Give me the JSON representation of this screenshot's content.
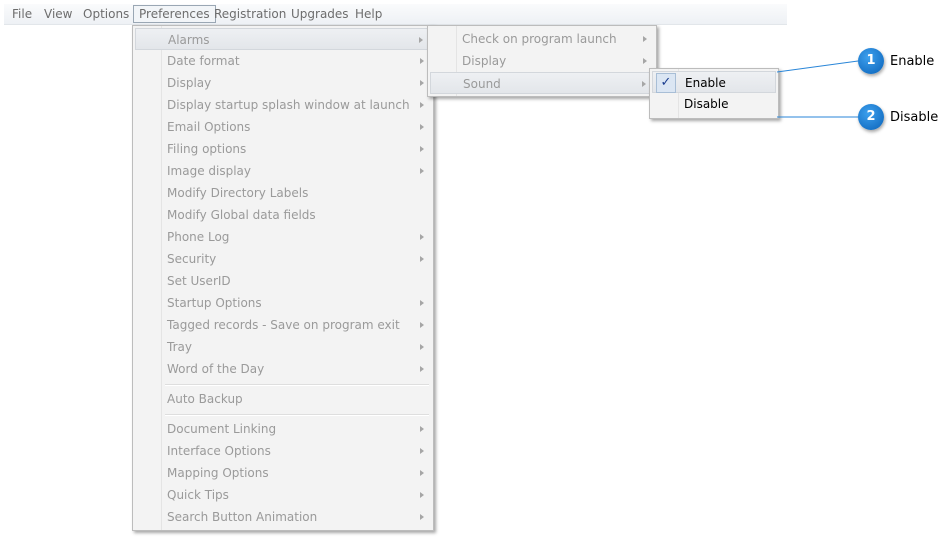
{
  "menubar": {
    "items": [
      "File",
      "View",
      "Options",
      "Preferences",
      "Registration",
      "Upgrades",
      "Help"
    ]
  },
  "preferences_menu": {
    "items": [
      {
        "label": "Alarms"
      },
      {
        "label": "Date format"
      },
      {
        "label": "Display"
      },
      {
        "label": "Display startup splash window at launch"
      },
      {
        "label": "Email Options"
      },
      {
        "label": "Filing options"
      },
      {
        "label": "Image display"
      },
      {
        "label": "Modify Directory Labels"
      },
      {
        "label": "Modify Global data fields"
      },
      {
        "label": "Phone Log"
      },
      {
        "label": "Security"
      },
      {
        "label": "Set UserID"
      },
      {
        "label": "Startup Options"
      },
      {
        "label": "Tagged records - Save on program exit"
      },
      {
        "label": "Tray"
      },
      {
        "label": "Word of the Day"
      },
      {
        "label": "Auto Backup"
      },
      {
        "label": "Document Linking"
      },
      {
        "label": "Interface Options"
      },
      {
        "label": "Mapping Options"
      },
      {
        "label": "Quick Tips"
      },
      {
        "label": "Search Button Animation"
      }
    ]
  },
  "alarms_menu": {
    "items": [
      {
        "label": "Check on program launch"
      },
      {
        "label": "Display"
      },
      {
        "label": "Sound"
      }
    ]
  },
  "sound_menu": {
    "items": [
      {
        "label": "Enable",
        "checked": true
      },
      {
        "label": "Disable",
        "checked": false
      }
    ],
    "check_glyph": "✓"
  },
  "callouts": [
    {
      "number": "1",
      "label": "Enable"
    },
    {
      "number": "2",
      "label": "Disable"
    }
  ],
  "colors": {
    "callout": "#1a7bd6",
    "callout_line": "#2a86d8"
  }
}
